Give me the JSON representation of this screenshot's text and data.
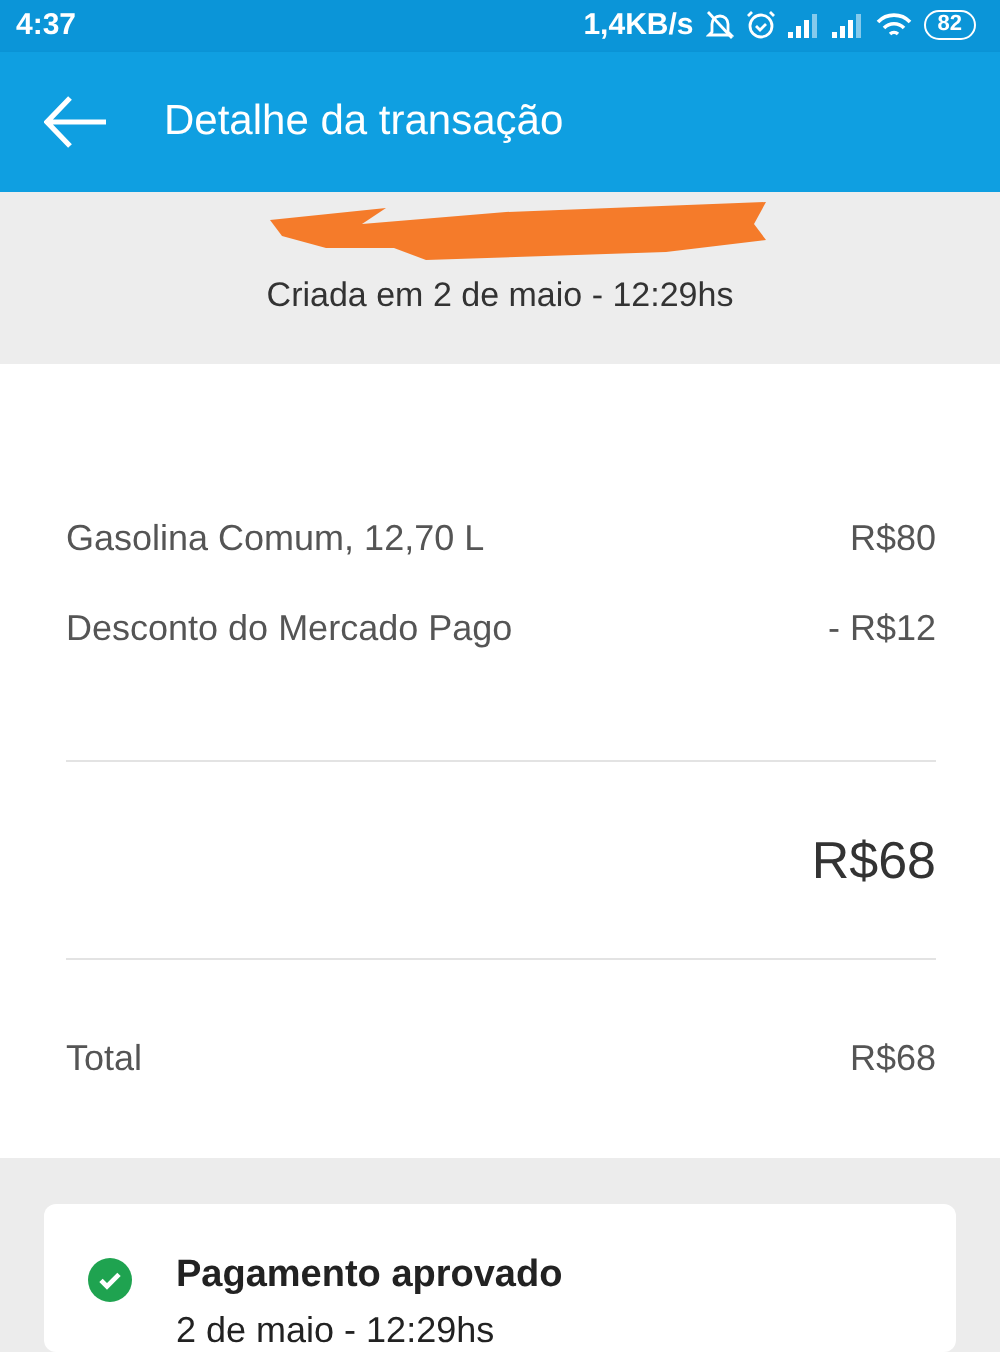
{
  "status_bar": {
    "time": "4:37",
    "speed": "1,4KB/s",
    "battery": "82"
  },
  "app_bar": {
    "title": "Detalhe da transação"
  },
  "header": {
    "created": "Criada em 2 de maio - 12:29hs"
  },
  "items": [
    {
      "label": "Gasolina Comum, 12,70 L",
      "amount": "R$80"
    },
    {
      "label": "Desconto do Mercado Pago",
      "amount": "- R$12"
    }
  ],
  "subtotal": "R$68",
  "total": {
    "label": "Total",
    "amount": "R$68"
  },
  "payment": {
    "status": "Pagamento aprovado",
    "date": "2 de maio - 12:29hs",
    "approved": true
  }
}
